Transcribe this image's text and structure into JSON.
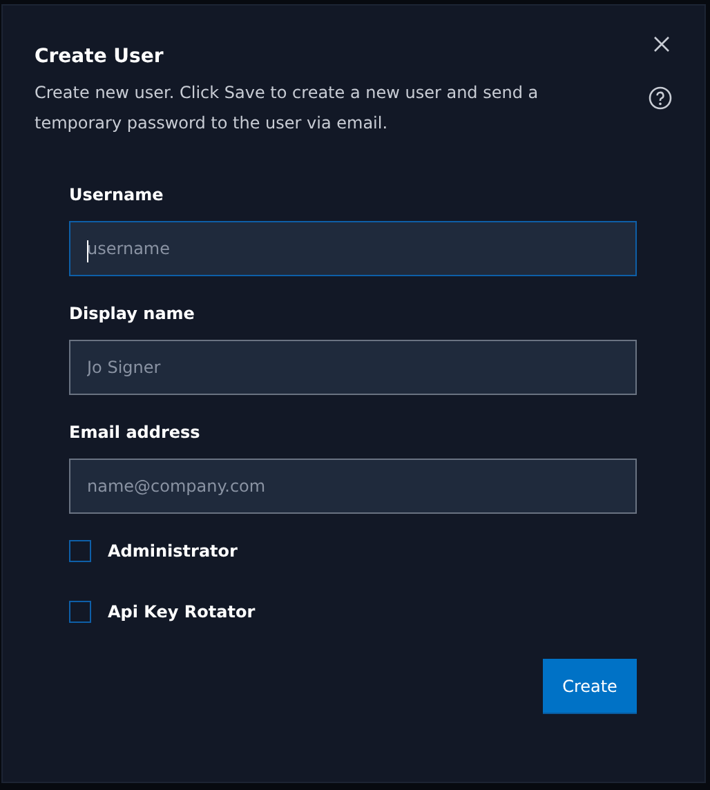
{
  "dialog": {
    "title": "Create User",
    "description": "Create new user. Click Save to create a new user and send a temporary password to the user via email."
  },
  "fields": [
    {
      "label": "Username",
      "placeholder": "username",
      "focused": true
    },
    {
      "label": "Display name",
      "placeholder": "Jo Signer",
      "focused": false
    },
    {
      "label": "Email address",
      "placeholder": "name@company.com",
      "focused": false
    }
  ],
  "checkboxes": [
    {
      "label": "Administrator",
      "checked": false
    },
    {
      "label": "Api Key Rotator",
      "checked": false
    }
  ],
  "buttons": [
    "Create"
  ]
}
